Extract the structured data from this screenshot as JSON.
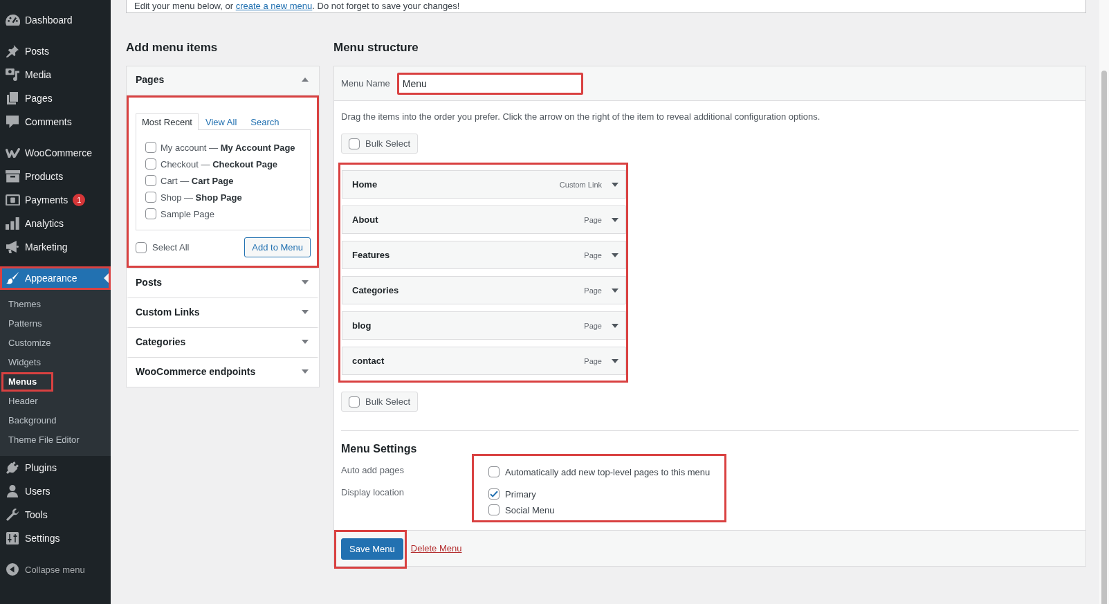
{
  "notice": {
    "before": "Edit your menu below, or ",
    "link": "create a new menu",
    "after": ". Do not forget to save your changes!"
  },
  "sidebar": {
    "groups": [
      [
        {
          "label": "Dashboard",
          "selected": false,
          "annotated": false
        }
      ],
      [
        {
          "label": "Posts",
          "selected": false,
          "annotated": false
        },
        {
          "label": "Media",
          "selected": false,
          "annotated": false
        },
        {
          "label": "Pages",
          "selected": false,
          "annotated": false
        },
        {
          "label": "Comments",
          "selected": false,
          "annotated": false
        }
      ],
      [
        {
          "label": "WooCommerce",
          "selected": false,
          "annotated": false
        },
        {
          "label": "Products",
          "selected": false,
          "annotated": false
        },
        {
          "label": "Payments",
          "selected": false,
          "annotated": false,
          "badge": "1"
        },
        {
          "label": "Analytics",
          "selected": false,
          "annotated": false
        },
        {
          "label": "Marketing",
          "selected": false,
          "annotated": false
        }
      ],
      [
        {
          "label": "Appearance",
          "selected": true,
          "annotated": true,
          "children": [
            {
              "label": "Themes",
              "selected": false,
              "annotated": false
            },
            {
              "label": "Patterns",
              "selected": false,
              "annotated": false
            },
            {
              "label": "Customize",
              "selected": false,
              "annotated": false
            },
            {
              "label": "Widgets",
              "selected": false,
              "annotated": false
            },
            {
              "label": "Menus",
              "selected": true,
              "annotated": true
            },
            {
              "label": "Header",
              "selected": false,
              "annotated": false
            },
            {
              "label": "Background",
              "selected": false,
              "annotated": false
            },
            {
              "label": "Theme File Editor",
              "selected": false,
              "annotated": false
            }
          ]
        },
        {
          "label": "Plugins",
          "selected": false,
          "annotated": false
        },
        {
          "label": "Users",
          "selected": false,
          "annotated": false
        },
        {
          "label": "Tools",
          "selected": false,
          "annotated": false
        },
        {
          "label": "Settings",
          "selected": false,
          "annotated": false
        }
      ]
    ],
    "collapse_label": "Collapse menu"
  },
  "add_menu_items": {
    "title": "Add menu items",
    "sections": [
      {
        "title": "Pages",
        "expanded": true,
        "annotated": true,
        "tabs": [
          {
            "label": "Most Recent",
            "selected": true
          },
          {
            "label": "View All",
            "selected": false
          },
          {
            "label": "Search",
            "selected": false
          }
        ],
        "items": [
          {
            "label": "My account — **My Account Page**",
            "checked": false
          },
          {
            "label": "Checkout — **Checkout Page**",
            "checked": false
          },
          {
            "label": "Cart — **Cart Page**",
            "checked": false
          },
          {
            "label": "Shop — **Shop Page**",
            "checked": false
          },
          {
            "label": "Sample Page",
            "checked": false
          }
        ],
        "select_all": {
          "label": "Select All",
          "checked": false
        },
        "button": "Add to Menu"
      },
      {
        "title": "Posts",
        "expanded": false,
        "annotated": false
      },
      {
        "title": "Custom Links",
        "expanded": false,
        "annotated": false
      },
      {
        "title": "Categories",
        "expanded": false,
        "annotated": false
      },
      {
        "title": "WooCommerce endpoints",
        "expanded": false,
        "annotated": false
      }
    ]
  },
  "menu_structure": {
    "title": "Menu structure",
    "name_label": "Menu Name",
    "name_value": "Menu",
    "name_annotated": true,
    "instructions": "Drag the items into the order you prefer. Click the arrow on the right of the item to reveal additional configuration options.",
    "bulk_select_top": {
      "label": "Bulk Select",
      "checked": false
    },
    "items_annotated": true,
    "items": [
      {
        "title": "Home",
        "type_label": "Custom Link"
      },
      {
        "title": "About",
        "type_label": "Page"
      },
      {
        "title": "Features",
        "type_label": "Page"
      },
      {
        "title": "Categories",
        "type_label": "Page"
      },
      {
        "title": "blog",
        "type_label": "Page"
      },
      {
        "title": "contact",
        "type_label": "Page"
      }
    ],
    "bulk_select_bottom": {
      "label": "Bulk Select",
      "checked": false
    },
    "settings": {
      "title": "Menu Settings",
      "annotated": true,
      "rows": [
        {
          "label": "Auto add pages",
          "options": [
            {
              "label": "Automatically add new top-level pages to this menu",
              "checked": false
            }
          ]
        },
        {
          "label": "Display location",
          "options": [
            {
              "label": "Primary",
              "checked": true
            },
            {
              "label": "Social Menu",
              "checked": false
            }
          ]
        }
      ]
    },
    "save_button": "Save Menu",
    "save_annotated": true,
    "delete_link": "Delete Menu"
  }
}
